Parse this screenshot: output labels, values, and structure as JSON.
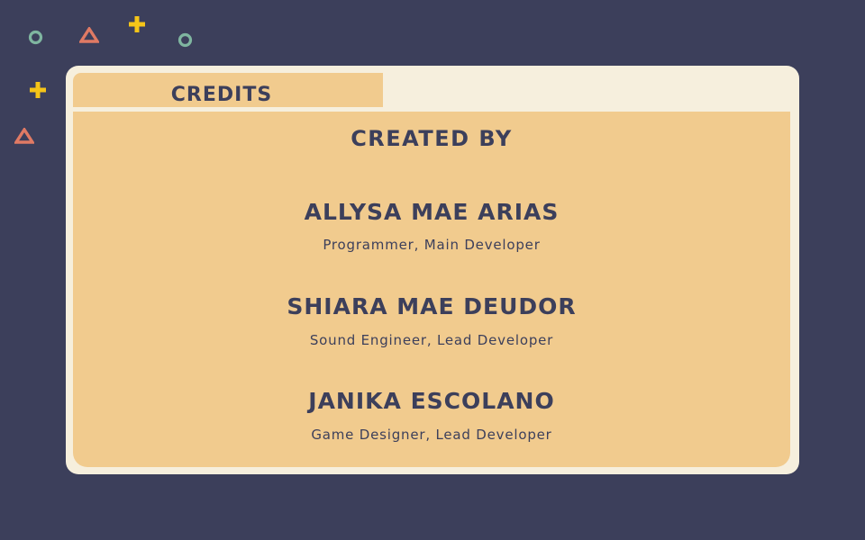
{
  "decorations": [
    {
      "icon": "ring-icon",
      "color": "#7fb5a0"
    },
    {
      "icon": "triangle-icon",
      "color": "#e07a64"
    },
    {
      "icon": "plus-icon",
      "color": "#f5c518"
    },
    {
      "icon": "ring-icon",
      "color": "#7fb5a0"
    },
    {
      "icon": "plus-icon",
      "color": "#f5c518"
    },
    {
      "icon": "triangle-icon",
      "color": "#e07a64"
    }
  ],
  "colors": {
    "background": "#3c3f5b",
    "window": "#f6efdd",
    "panel": "#f1cb8e",
    "text": "#3c3f5b"
  },
  "credits": {
    "tab_label": "CREDITS",
    "heading": "CREATED BY",
    "people": [
      {
        "name": "ALLYSA MAE ARIAS",
        "role": "Programmer, Main Developer"
      },
      {
        "name": "SHIARA MAE DEUDOR",
        "role": "Sound Engineer, Lead Developer"
      },
      {
        "name": "JANIKA ESCOLANO",
        "role": "Game Designer, Lead Developer"
      }
    ]
  }
}
